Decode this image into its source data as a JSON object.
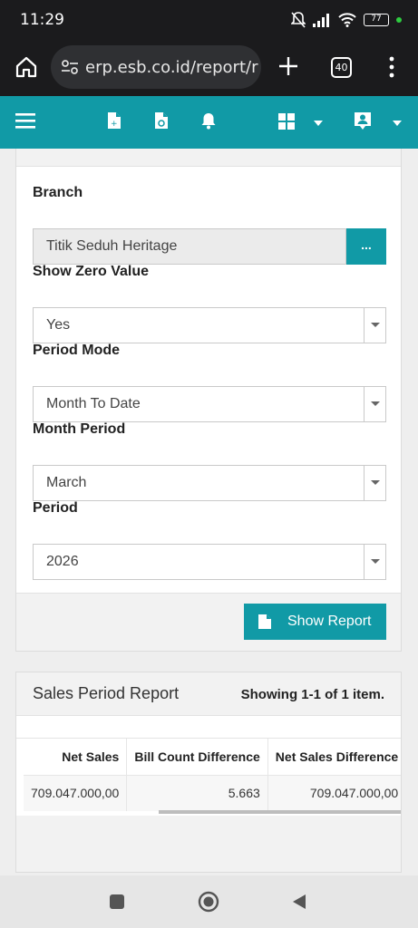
{
  "status_bar": {
    "time": "11:29",
    "battery": "77"
  },
  "browser": {
    "url": "erp.esb.co.id/report/r",
    "tab_count": "40"
  },
  "form": {
    "branch": {
      "label": "Branch",
      "value": "Titik Seduh Heritage",
      "lookup_label": "..."
    },
    "show_zero": {
      "label": "Show Zero Value",
      "value": "Yes"
    },
    "period_mode": {
      "label": "Period Mode",
      "value": "Month To Date"
    },
    "month_period": {
      "label": "Month Period",
      "value": "March"
    },
    "period": {
      "label": "Period",
      "value": "2026"
    },
    "show_report_label": "Show Report"
  },
  "report": {
    "title": "Sales Period Report",
    "summary": "Showing 1-1 of 1 item.",
    "columns": [
      "Net Sales",
      "Bill Count Difference",
      "Net Sales Difference"
    ],
    "rows": [
      [
        "709.047.000,00",
        "5.663",
        "709.047.000,00"
      ]
    ]
  },
  "colors": {
    "accent": "#119aa6",
    "status_bg": "#1b1b1d"
  }
}
